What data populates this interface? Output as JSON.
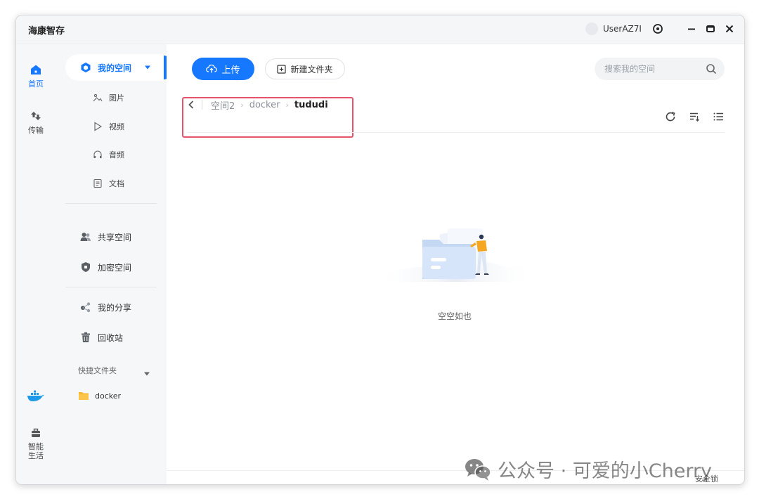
{
  "window": {
    "title": "海康智存",
    "user_name": "UserAZ7I"
  },
  "rail": {
    "items": [
      {
        "label": "首页"
      },
      {
        "label": "传输"
      },
      {
        "label": "智能\n生活"
      }
    ]
  },
  "sidebar": {
    "my_space": "我的空间",
    "sub_items": [
      {
        "label": "图片"
      },
      {
        "label": "视频"
      },
      {
        "label": "音频"
      },
      {
        "label": "文档"
      }
    ],
    "shared_space": "共享空间",
    "encrypted_space": "加密空间",
    "my_share": "我的分享",
    "recycle_bin": "回收站",
    "quick_folder_label": "快捷文件夹",
    "quick_folders": [
      {
        "label": "docker"
      }
    ]
  },
  "toolbar": {
    "upload_label": "上传",
    "new_folder_label": "新建文件夹",
    "search_placeholder": "搜索我的空间"
  },
  "breadcrumb": [
    "空间2",
    "docker",
    "tududi"
  ],
  "empty_state": {
    "text": "空空如也"
  },
  "status_bar": {
    "text": "安全锁"
  },
  "watermark": {
    "text": "公众号 · 可爱的小Cherry"
  },
  "colors": {
    "accent": "#1677ff",
    "highlight": "#e5546a"
  }
}
